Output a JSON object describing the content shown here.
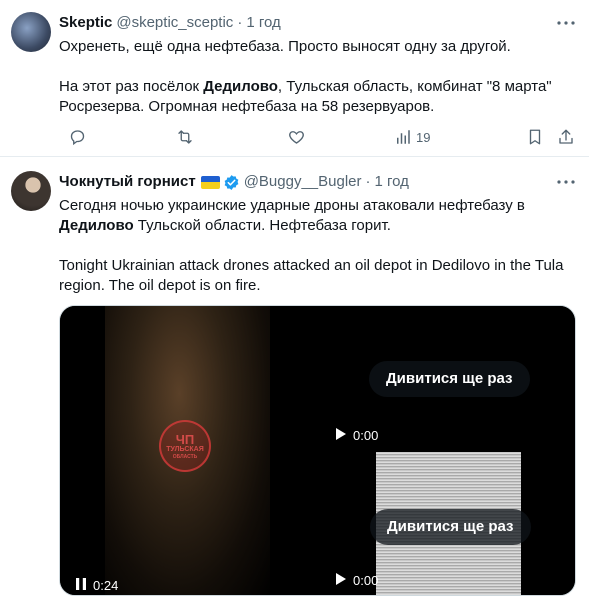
{
  "tweet1": {
    "author_name": "Skeptic",
    "handle": "@skeptic_sceptic",
    "separator": "·",
    "time": "1 год",
    "line1": "Охренеть, ещё одна нефтебаза. Просто выносят одну за другой.",
    "line2_pre": "На этот раз посёлок ",
    "line2_bold": "Дедилово",
    "line2_post": ", Тульская область, комбинат \"8 марта\" Росрезерва. Огромная нефтебаза на 58 резервуаров.",
    "stats_count": "19"
  },
  "tweet2": {
    "author_name": "Чокнутый горнист",
    "handle": "@Buggy__Bugler",
    "separator": "·",
    "time": "1 год",
    "ru_pre": "Сегодня ночью украинские ударные дроны атаковали нефтебазу в ",
    "ru_bold": "Дедилово",
    "ru_post": " Тульской области. Нефтебаза горит.",
    "en_text": "Tonight Ukrainian attack drones attacked an oil depot in Dedilovo in the Tula region. The oil depot is on fire.",
    "flag_colors": [
      "#1f5fd0",
      "#f5cf1c"
    ]
  },
  "media": {
    "video1_time": "0:24",
    "video2_time": "0:00",
    "video3_time": "0:00",
    "replay_label": "Дивитися ще раз",
    "watermark_top": "ЧП",
    "watermark_bottom": "ТУЛЬСКАЯ",
    "watermark_sub": "ОБЛАСТЬ"
  },
  "icons": {
    "more": "more-dots-icon",
    "reply": "reply-icon",
    "retweet": "retweet-icon",
    "like": "like-icon",
    "stats": "stats-icon",
    "bookmark": "bookmark-icon",
    "share": "share-icon",
    "verified": "verified-badge-icon",
    "pause": "pause-icon",
    "play": "play-icon"
  },
  "colors": {
    "accent": "#1d9bf0",
    "muted": "#536471",
    "text": "#0f1419"
  }
}
